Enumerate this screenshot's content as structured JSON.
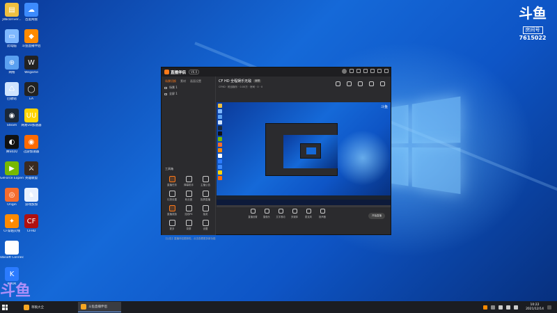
{
  "desktop": {
    "icons_left": [
      {
        "label": "JdbcDriver...",
        "color": "#f0c040",
        "glyph": "▤"
      },
      {
        "label": "此电脑",
        "color": "#7fb8ff",
        "glyph": "▭"
      },
      {
        "label": "网络",
        "color": "#5aa0f0",
        "glyph": "⊕"
      },
      {
        "label": "回收站",
        "color": "#cfe4ff",
        "glyph": "♺"
      },
      {
        "label": "Steam",
        "color": "#1b2838",
        "glyph": "◉"
      },
      {
        "label": "腾讯QQ",
        "color": "#111111",
        "glyph": "◐"
      },
      {
        "label": "GeForce Experience",
        "color": "#76b900",
        "glyph": "▶"
      },
      {
        "label": "Origin",
        "color": "#f56c2d",
        "glyph": "◎"
      },
      {
        "label": "CF穿越火线",
        "color": "#ff8a00",
        "glyph": "✦"
      },
      {
        "label": "Ubisoft Connect",
        "color": "#ffffff",
        "glyph": "◍"
      },
      {
        "label": "KOOK",
        "color": "#2b7bff",
        "glyph": "K"
      }
    ],
    "icons_right": [
      {
        "label": "百度网盘",
        "color": "#3d8bfd",
        "glyph": "☁"
      },
      {
        "label": "斗鱼直播伴侣",
        "color": "#ff8a00",
        "glyph": "◆"
      },
      {
        "label": "Wegame",
        "color": "#222222",
        "glyph": "W"
      },
      {
        "label": "EA",
        "color": "#222222",
        "glyph": "◯"
      },
      {
        "label": "网易UU加速器",
        "color": "#ffd400",
        "glyph": "UU"
      },
      {
        "label": "迅游加速器",
        "color": "#ff6a00",
        "glyph": "◉"
      },
      {
        "label": "英雄联盟",
        "color": "#3a2a20",
        "glyph": "⚔"
      },
      {
        "label": "游戏加加",
        "color": "#e8f0ff",
        "glyph": "♞"
      },
      {
        "label": "CFHD",
        "color": "#b01010",
        "glyph": "CF"
      }
    ],
    "watermark": "斗鱼",
    "douyu_badge": {
      "logo": "斗鱼",
      "room_label": "房间号",
      "room_number": "7615022"
    }
  },
  "app": {
    "title": "直播伴侣",
    "version": "V6.0",
    "left_tabs": [
      "场景切换",
      "素材",
      "画面设置"
    ],
    "scenes": [
      "场景 1",
      "全屏 1"
    ],
    "tools_title": "工具箱",
    "tools": [
      {
        "label": "直播任务",
        "highlight": true
      },
      {
        "label": "弹幕助手",
        "highlight": false
      },
      {
        "label": "主播公告",
        "highlight": false
      },
      {
        "label": "礼物设置",
        "highlight": false
      },
      {
        "label": "粉丝团",
        "highlight": false
      },
      {
        "label": "投屏直播",
        "highlight": false
      },
      {
        "label": "直播奖励",
        "highlight": true
      },
      {
        "label": "连线PK",
        "highlight": false
      },
      {
        "label": "抽奖",
        "highlight": false
      },
      {
        "label": "更多",
        "highlight": false
      },
      {
        "label": "录屏",
        "highlight": false
      },
      {
        "label": "设置",
        "highlight": false
      }
    ],
    "notice": "【公告】直播伴侣更新啦，点击查看更多新功能",
    "room_title": "CF HD 全程娱乐无敌",
    "edit_label": "编辑",
    "meta": "CFHD · 枪战娱乐 · 0.00万 · 房间 · 0 · 0",
    "controls": [
      "直播设置",
      "摄像头",
      "文字滚动",
      "多媒体",
      "麦克风",
      "扬声器"
    ],
    "start_label": "开始直播"
  },
  "taskbar": {
    "tasks": [
      "草稿大全",
      "斗鱼直播伴侣"
    ],
    "time": "10:22",
    "date": "2021/12/14"
  }
}
